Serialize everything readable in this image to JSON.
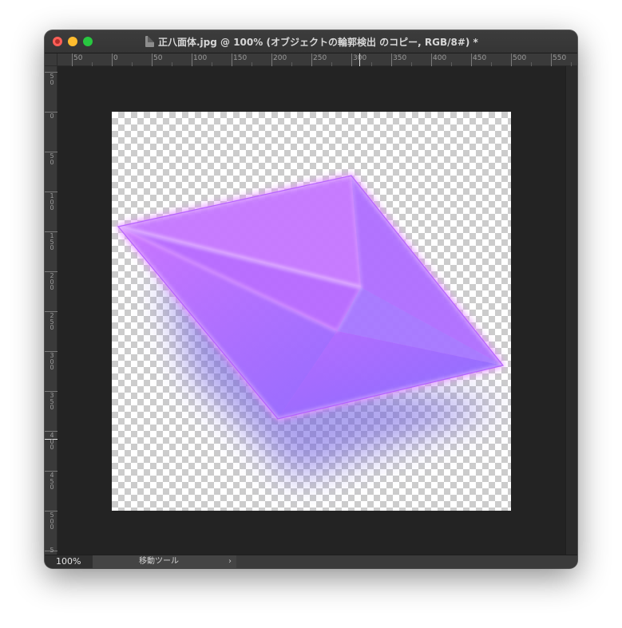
{
  "window": {
    "title": "正八面体.jpg @ 100% (オブジェクトの輪郭検出 のコピー, RGB/8#) *"
  },
  "rulers": {
    "top_labels": [
      "50",
      "0",
      "50",
      "100",
      "150",
      "200",
      "250",
      "300",
      "350",
      "400",
      "450",
      "500",
      "550"
    ],
    "left_labels": [
      "50",
      "0",
      "50",
      "100",
      "150",
      "200",
      "250",
      "300",
      "350",
      "400",
      "450",
      "500",
      "5"
    ]
  },
  "statusbar": {
    "zoom": "100%",
    "tool": "移動ツール",
    "arrow": "›"
  },
  "colors": {
    "accent_purple": "#9b5cff",
    "glow_pink": "#e07bff",
    "canvas_bg": "#232323"
  }
}
